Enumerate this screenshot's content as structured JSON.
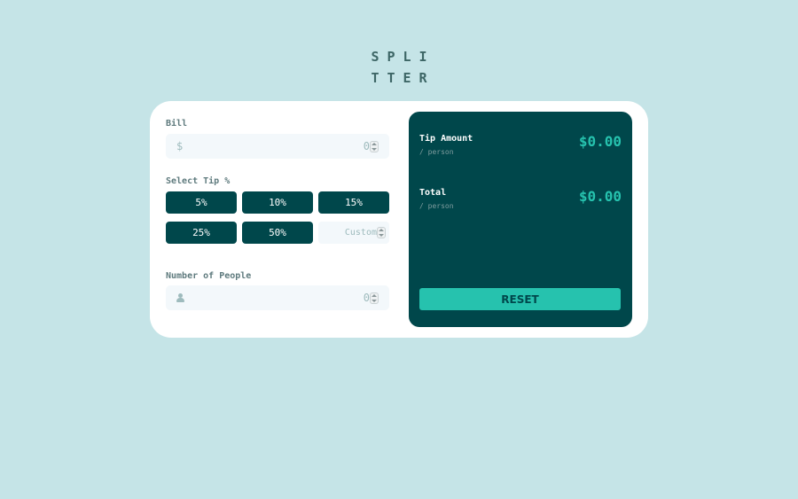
{
  "logo": {
    "line1": "SPLI",
    "line2": "TTER"
  },
  "bill": {
    "label": "Bill",
    "prefix": "$",
    "value": "0"
  },
  "tip": {
    "label": "Select Tip %",
    "options": [
      "5%",
      "10%",
      "15%",
      "25%",
      "50%"
    ],
    "custom_placeholder": "Custom"
  },
  "people": {
    "label": "Number of People",
    "value": "0",
    "icon": "person-icon"
  },
  "results": {
    "tip_amount": {
      "title": "Tip Amount",
      "sub": "/ person",
      "value": "$0.00"
    },
    "total": {
      "title": "Total",
      "sub": "/ person",
      "value": "$0.00"
    },
    "reset_label": "RESET"
  },
  "colors": {
    "background": "#c5e4e7",
    "dark_cyan": "#00474b",
    "strong_cyan": "#26c2ae",
    "input_bg": "#f3f8fb"
  }
}
